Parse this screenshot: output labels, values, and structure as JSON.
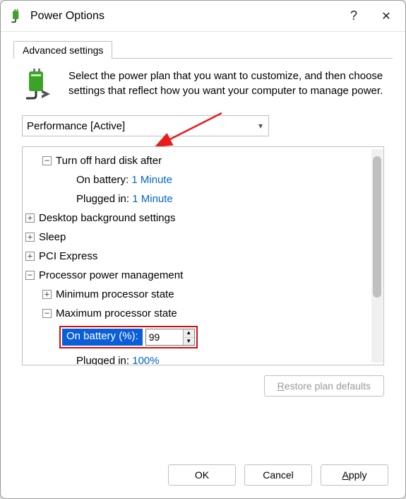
{
  "titlebar": {
    "title": "Power Options",
    "help": "?",
    "close": "✕"
  },
  "tabs": {
    "advanced": "Advanced settings"
  },
  "intro": "Select the power plan that you want to customize, and then choose settings that reflect how you want your computer to manage power.",
  "plan_dropdown": {
    "selected": "Performance [Active]"
  },
  "tree": {
    "hard_disk": {
      "label": "Turn off hard disk after",
      "on_battery_label": "On battery:",
      "on_battery_value": "1 Minute",
      "plugged_in_label": "Plugged in:",
      "plugged_in_value": "1 Minute"
    },
    "desktop_bg": "Desktop background settings",
    "sleep": "Sleep",
    "pci": "PCI Express",
    "cpu": {
      "label": "Processor power management",
      "min": "Minimum processor state",
      "max": {
        "label": "Maximum processor state",
        "on_battery_label": "On battery (%):",
        "on_battery_value": "99",
        "plugged_in_label": "Plugged in:",
        "plugged_in_value": "100%"
      }
    }
  },
  "buttons": {
    "restore_prefix": "R",
    "restore_rest": "estore plan defaults",
    "ok": "OK",
    "cancel": "Cancel",
    "apply_prefix": "A",
    "apply_rest": "pply"
  }
}
